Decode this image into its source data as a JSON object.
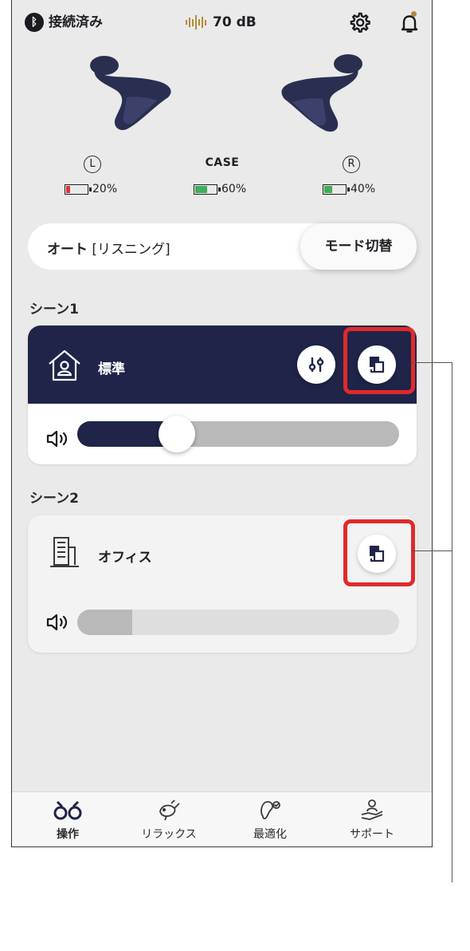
{
  "status": {
    "bluetooth_label": "接続済み",
    "noise_level": "70 dB",
    "settings_icon": "gear-icon",
    "notification_icon": "bell-icon",
    "notification_dot_color": "#b5873a"
  },
  "device": {
    "left": {
      "side": "L",
      "battery": "20%",
      "battery_level": 0.2,
      "battery_color": "#e0343d"
    },
    "case": {
      "label": "CASE",
      "battery": "60%",
      "battery_level": 0.6,
      "battery_color": "#3fae5a"
    },
    "right": {
      "side": "R",
      "battery": "40%",
      "battery_level": 0.4,
      "battery_color": "#3fae5a"
    }
  },
  "mode": {
    "name": "オート",
    "sub": "[リスニング]",
    "switch_label": "モード切替"
  },
  "scenes": [
    {
      "title": "シーン1",
      "name": "標準",
      "icon": "home-person-icon",
      "volume": 0.31,
      "active": true
    },
    {
      "title": "シーン2",
      "name": "オフィス",
      "icon": "office-building-icon",
      "volume": 0.17,
      "active": false
    }
  ],
  "colors": {
    "active_header": "#1f2448",
    "highlight": "#e02a2a",
    "accent_gold": "#b68a3a"
  },
  "nav": [
    {
      "label": "操作",
      "icon": "controls-icon",
      "active": true
    },
    {
      "label": "リラックス",
      "icon": "bird-icon",
      "active": false
    },
    {
      "label": "最適化",
      "icon": "ear-check-icon",
      "active": false
    },
    {
      "label": "サポート",
      "icon": "hand-person-icon",
      "active": false
    }
  ]
}
